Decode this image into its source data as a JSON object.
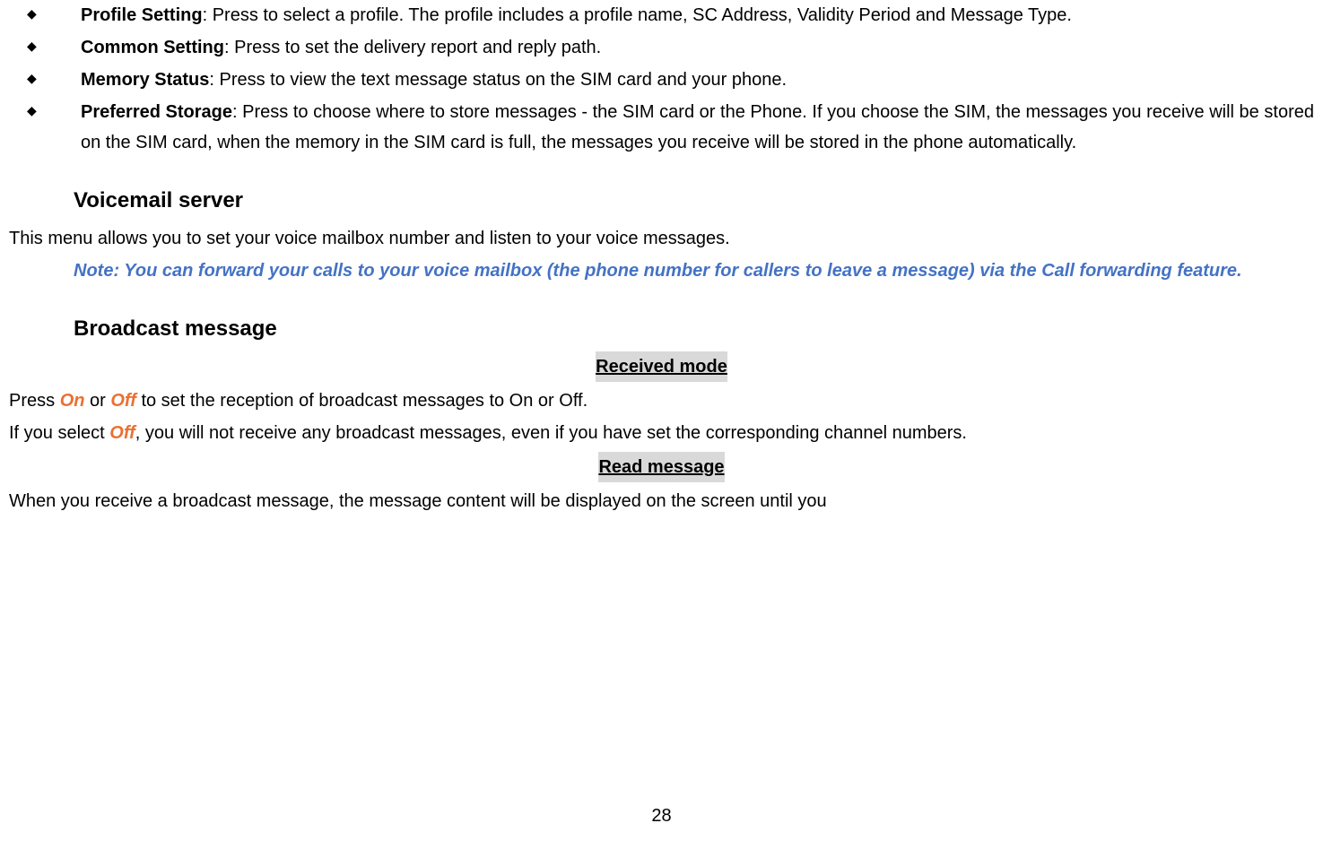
{
  "bullets": [
    {
      "bold": "Profile Setting",
      "rest": ": Press to select a profile. The profile includes a profile name, SC Address, Validity Period and Message Type."
    },
    {
      "bold": "Common Setting",
      "rest": ": Press to set the delivery report and reply path."
    },
    {
      "bold": "Memory Status",
      "rest": ": Press to view the text message status on the SIM card and your phone."
    },
    {
      "bold": "Preferred Storage",
      "rest": ": Press to choose where to store messages - the SIM card or the Phone. If you choose the SIM, the messages you receive will be stored on the SIM card, when the memory in the SIM card is full, the messages you receive will be stored in the phone automatically."
    }
  ],
  "voicemail": {
    "heading": "Voicemail server",
    "body": "This menu allows you to set your voice mailbox number and listen to your voice messages.",
    "note": "Note: You can forward your calls to your voice mailbox (the phone number for callers to leave a message) via the Call forwarding feature."
  },
  "broadcast": {
    "heading": "Broadcast message",
    "received_mode": {
      "heading": "Received mode",
      "line1_pre": "Press ",
      "on": "On",
      "line1_mid": " or ",
      "off": "Off",
      "line1_post": " to set the reception of broadcast messages to On or Off.",
      "line2_pre": "If you select ",
      "off2": "Off",
      "line2_post": ", you will not receive any broadcast messages, even if you have set the corresponding channel numbers."
    },
    "read_message": {
      "heading": "Read message",
      "body": "When you receive a broadcast message, the message content will be displayed on the screen until you"
    }
  },
  "page_number": "28",
  "bullet_char": "◆"
}
